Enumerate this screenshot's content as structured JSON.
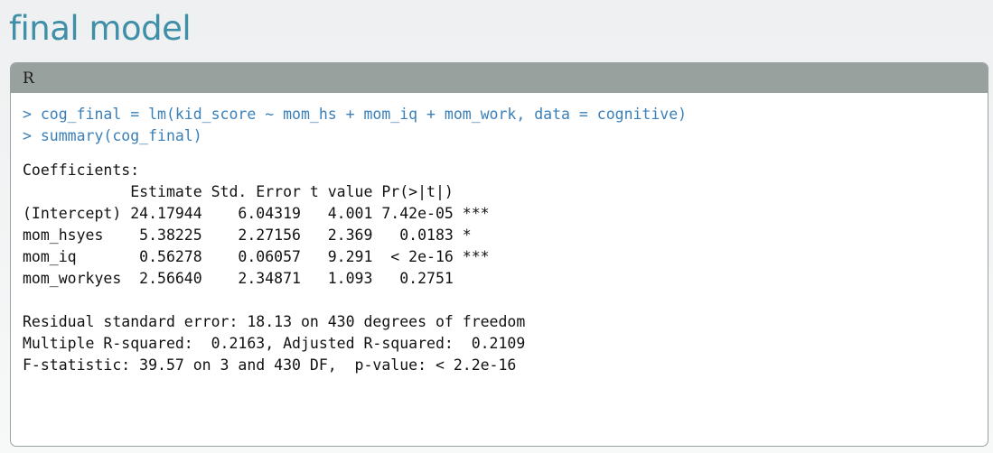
{
  "title": "final model",
  "code_box": {
    "language": "R",
    "commands": [
      "> cog_final = lm(kid_score ~ mom_hs + mom_iq + mom_work, data = cognitive)",
      "> summary(cog_final)"
    ],
    "coefficients": {
      "heading": "Coefficients:",
      "header_row": "            Estimate Std. Error t value Pr(>|t|)",
      "rows": [
        "(Intercept) 24.17944    6.04319   4.001 7.42e-05 ***",
        "mom_hsyes    5.38225    2.27156   2.369   0.0183 *",
        "mom_iq       0.56278    0.06057   9.291  < 2e-16 ***",
        "mom_workyes  2.56640    2.34871   1.093   0.2751"
      ]
    },
    "summary_lines": [
      "Residual standard error: 18.13 on 430 degrees of freedom",
      "Multiple R-squared:  0.2163, Adjusted R-squared:  0.2109",
      "F-statistic: 39.57 on 3 and 430 DF,  p-value: < 2.2e-16"
    ]
  },
  "colors": {
    "title": "#3f8fa8",
    "command": "#3a7fb8",
    "header_bar": "#98a19e"
  }
}
